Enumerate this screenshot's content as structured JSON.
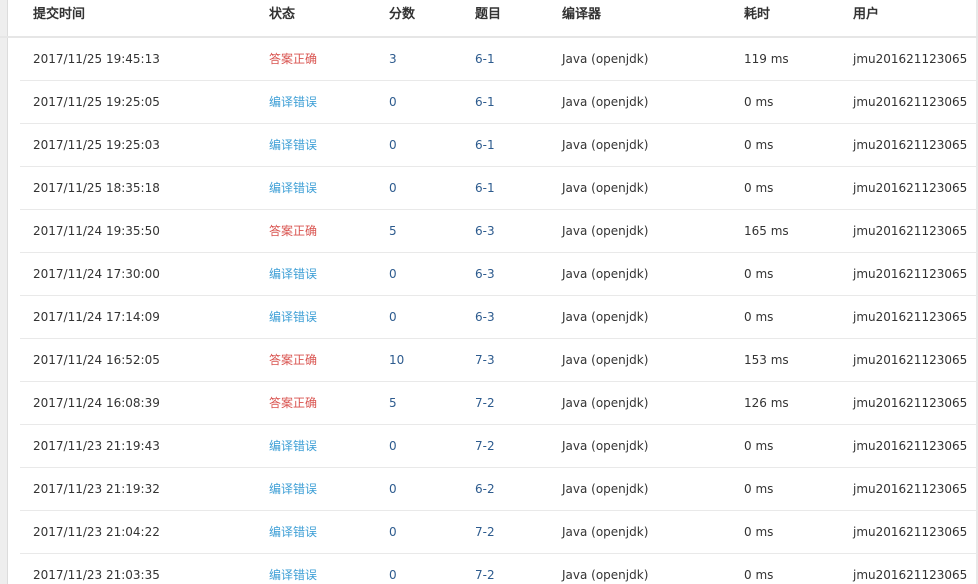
{
  "headers": {
    "time": "提交时间",
    "status": "状态",
    "score": "分数",
    "problem": "题目",
    "compiler": "编译器",
    "elapsed": "耗时",
    "user": "用户"
  },
  "colors": {
    "accepted": "#d9534f",
    "compile_error": "#3e9fd6",
    "link": "#2d5b8e"
  },
  "rows": [
    {
      "time": "2017/11/25 19:45:13",
      "status": "答案正确",
      "kind": "ac",
      "score": "3",
      "problem": "6-1",
      "compiler": "Java (openjdk)",
      "elapsed": "119 ms",
      "user": "jmu201621123065"
    },
    {
      "time": "2017/11/25 19:25:05",
      "status": "编译错误",
      "kind": "ce",
      "score": "0",
      "problem": "6-1",
      "compiler": "Java (openjdk)",
      "elapsed": "0 ms",
      "user": "jmu201621123065"
    },
    {
      "time": "2017/11/25 19:25:03",
      "status": "编译错误",
      "kind": "ce",
      "score": "0",
      "problem": "6-1",
      "compiler": "Java (openjdk)",
      "elapsed": "0 ms",
      "user": "jmu201621123065"
    },
    {
      "time": "2017/11/25 18:35:18",
      "status": "编译错误",
      "kind": "ce",
      "score": "0",
      "problem": "6-1",
      "compiler": "Java (openjdk)",
      "elapsed": "0 ms",
      "user": "jmu201621123065"
    },
    {
      "time": "2017/11/24 19:35:50",
      "status": "答案正确",
      "kind": "ac",
      "score": "5",
      "problem": "6-3",
      "compiler": "Java (openjdk)",
      "elapsed": "165 ms",
      "user": "jmu201621123065"
    },
    {
      "time": "2017/11/24 17:30:00",
      "status": "编译错误",
      "kind": "ce",
      "score": "0",
      "problem": "6-3",
      "compiler": "Java (openjdk)",
      "elapsed": "0 ms",
      "user": "jmu201621123065"
    },
    {
      "time": "2017/11/24 17:14:09",
      "status": "编译错误",
      "kind": "ce",
      "score": "0",
      "problem": "6-3",
      "compiler": "Java (openjdk)",
      "elapsed": "0 ms",
      "user": "jmu201621123065"
    },
    {
      "time": "2017/11/24 16:52:05",
      "status": "答案正确",
      "kind": "ac",
      "score": "10",
      "problem": "7-3",
      "compiler": "Java (openjdk)",
      "elapsed": "153 ms",
      "user": "jmu201621123065"
    },
    {
      "time": "2017/11/24 16:08:39",
      "status": "答案正确",
      "kind": "ac",
      "score": "5",
      "problem": "7-2",
      "compiler": "Java (openjdk)",
      "elapsed": "126 ms",
      "user": "jmu201621123065"
    },
    {
      "time": "2017/11/23 21:19:43",
      "status": "编译错误",
      "kind": "ce",
      "score": "0",
      "problem": "7-2",
      "compiler": "Java (openjdk)",
      "elapsed": "0 ms",
      "user": "jmu201621123065"
    },
    {
      "time": "2017/11/23 21:19:32",
      "status": "编译错误",
      "kind": "ce",
      "score": "0",
      "problem": "6-2",
      "compiler": "Java (openjdk)",
      "elapsed": "0 ms",
      "user": "jmu201621123065"
    },
    {
      "time": "2017/11/23 21:04:22",
      "status": "编译错误",
      "kind": "ce",
      "score": "0",
      "problem": "7-2",
      "compiler": "Java (openjdk)",
      "elapsed": "0 ms",
      "user": "jmu201621123065"
    },
    {
      "time": "2017/11/23 21:03:35",
      "status": "编译错误",
      "kind": "ce",
      "score": "0",
      "problem": "7-2",
      "compiler": "Java (openjdk)",
      "elapsed": "0 ms",
      "user": "jmu201621123065"
    }
  ]
}
